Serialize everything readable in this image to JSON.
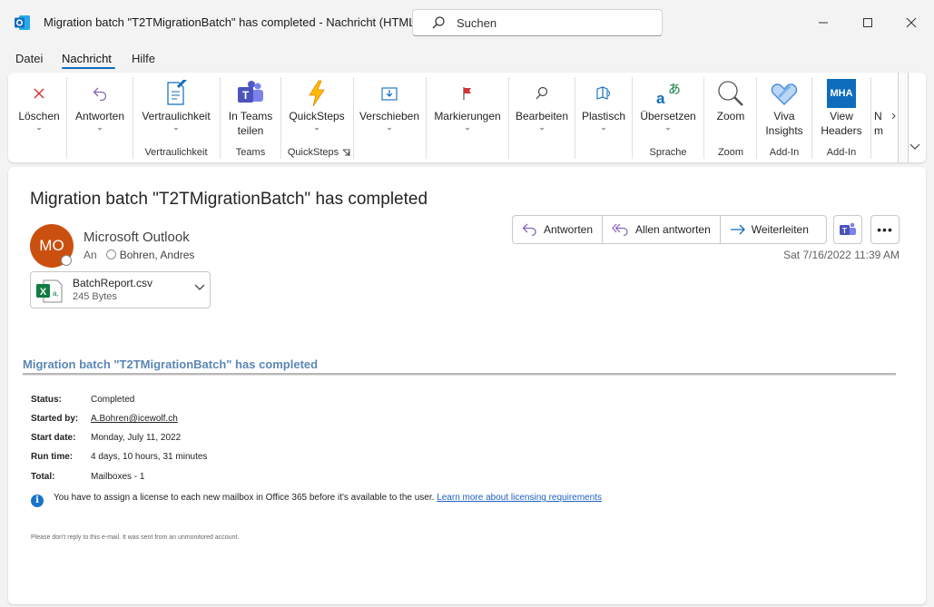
{
  "window": {
    "title": "Migration batch \"T2TMigrationBatch\" has completed  -  Nachricht (HTML)",
    "search_placeholder": "Suchen"
  },
  "menu": [
    {
      "label": "Datei"
    },
    {
      "label": "Nachricht",
      "active": true
    },
    {
      "label": "Hilfe"
    }
  ],
  "ribbon": {
    "delete": "Löschen",
    "reply": "Antworten",
    "sensitivity": "Vertraulichkeit",
    "teams_share_1": "In Teams",
    "teams_share_2": "teilen",
    "quicksteps": "QuickSteps",
    "move": "Verschieben",
    "tags": "Markierungen",
    "edit": "Bearbeiten",
    "immersive": "Plastisch",
    "translate": "Übersetzen",
    "zoom": "Zoom",
    "viva_1": "Viva",
    "viva_2": "Insights",
    "mha_badge": "MHA",
    "view_headers_1": "View",
    "view_headers_2": "Headers",
    "cut_1": "N",
    "cut_2": "m",
    "groups": {
      "sensitivity": "Vertraulichkeit",
      "teams": "Teams",
      "quicksteps": "QuickSteps",
      "language": "Sprache",
      "zoom": "Zoom",
      "addin1": "Add-In",
      "addin2": "Add-In"
    }
  },
  "message": {
    "subject": "Migration batch \"T2TMigrationBatch\" has completed",
    "avatar_initials": "MO",
    "sender": "Microsoft Outlook",
    "to_label": "An",
    "recipient": "Bohren, Andres",
    "attachment": {
      "name": "BatchReport.csv",
      "size": "245 Bytes"
    },
    "actions": {
      "reply": "Antworten",
      "reply_all": "Allen antworten",
      "forward": "Weiterleiten"
    },
    "more": "•••",
    "date": "Sat 7/16/2022 11:39 AM"
  },
  "body": {
    "title": "Migration batch \"T2TMigrationBatch\" has completed",
    "rows": [
      {
        "key": "Status:",
        "value": "Completed"
      },
      {
        "key": "Started by:",
        "value": "A.Bohren@icewolf.ch",
        "link": true
      },
      {
        "key": "Start date:",
        "value": "Monday, July 11, 2022"
      },
      {
        "key": "Run time:",
        "value": "4 days, 10 hours, 31 minutes"
      },
      {
        "key": "Total:",
        "value": "Mailboxes - 1"
      }
    ],
    "info_text": "You have to assign a license to each new mailbox in Office 365 before it's available to the user.",
    "info_link": "Learn more about licensing requirements",
    "footer": "Please don't reply to this e-mail. It was sent from an unmonitored account."
  }
}
